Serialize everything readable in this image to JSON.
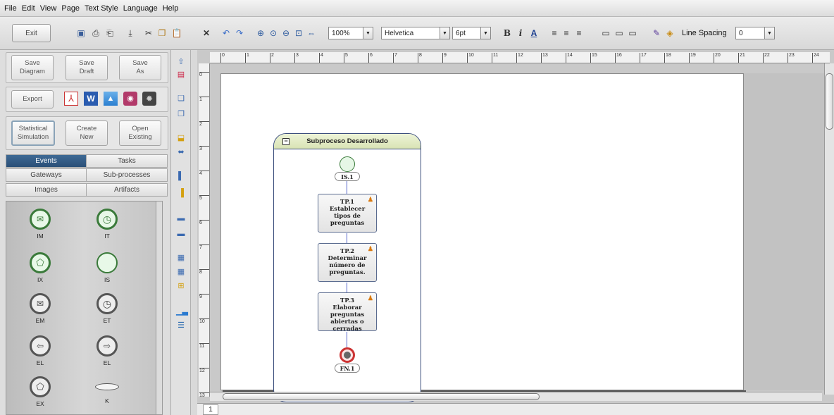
{
  "menu": [
    "File",
    "Edit",
    "View",
    "Page",
    "Text Style",
    "Language",
    "Help"
  ],
  "toolbar": {
    "exit_label": "Exit",
    "zoom_value": "100%",
    "font_value": "Helvetica",
    "size_value": "6pt",
    "line_spacing_label": "Line Spacing",
    "line_spacing_value": "0"
  },
  "left_panel": {
    "save_buttons": [
      {
        "label": "Save\nDiagram"
      },
      {
        "label": "Save\nDraft"
      },
      {
        "label": "Save\nAs"
      }
    ],
    "export_label": "Export",
    "sim_buttons": [
      {
        "label": "Statistical\nSimulation"
      },
      {
        "label": "Create\nNew"
      },
      {
        "label": "Open\nExisting"
      }
    ],
    "tabs": [
      "Events",
      "Tasks",
      "Gateways",
      "Sub-processes",
      "Images",
      "Artifacts"
    ],
    "active_tab": "Events",
    "palette": [
      "IM",
      "IT",
      "IX",
      "IS",
      "EM",
      "ET",
      "EL",
      "EL",
      "EX",
      "K"
    ]
  },
  "diagram": {
    "pool_title": "Subproceso Desarrollado",
    "start_label": "IS.1",
    "tasks": [
      {
        "id": "TP.1",
        "text": "Establecer tipos de preguntas"
      },
      {
        "id": "TP.2",
        "text": "Determinar número de preguntas."
      },
      {
        "id": "TP.3",
        "text": "Elaborar preguntas abiertas o cerradas"
      }
    ],
    "end_label": "FN.1"
  },
  "ruler": {
    "h": [
      "0",
      "1",
      "2",
      "3",
      "4",
      "5",
      "6",
      "7",
      "8",
      "9",
      "10",
      "11",
      "12",
      "13",
      "14",
      "15",
      "16",
      "17",
      "18",
      "19",
      "20",
      "21",
      "22",
      "23",
      "24"
    ],
    "v": [
      "0",
      "1",
      "2",
      "3",
      "4",
      "5",
      "6",
      "7",
      "8",
      "9",
      "10",
      "11",
      "12",
      "13"
    ]
  },
  "page_tab": "1",
  "colors": {
    "accent": "#2f557f",
    "pool_border": "#3c4f7d",
    "flow": "#5566cc"
  }
}
